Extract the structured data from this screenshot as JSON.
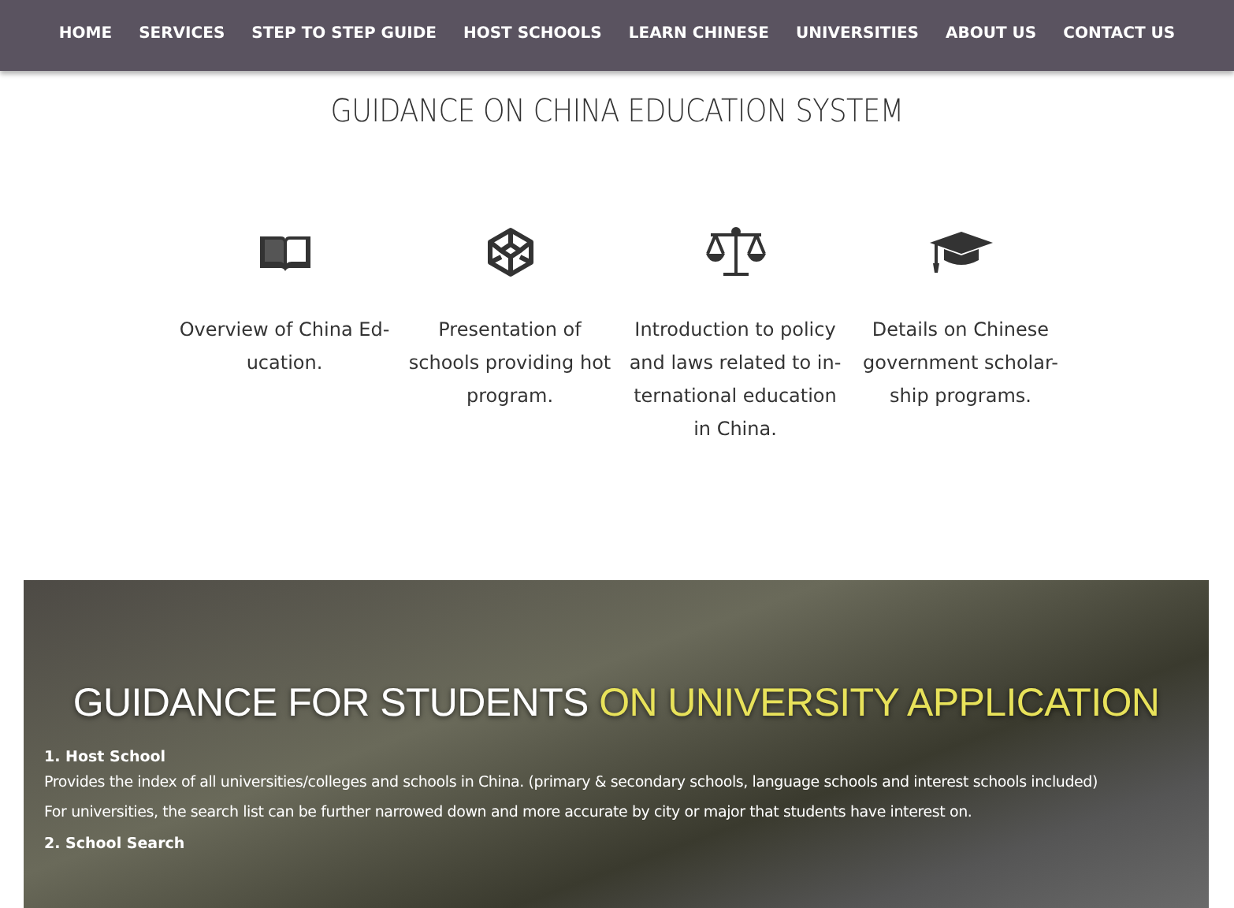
{
  "nav": {
    "items": [
      {
        "label": "HOME"
      },
      {
        "label": "SERVICES"
      },
      {
        "label": "STEP TO STEP GUIDE"
      },
      {
        "label": "HOST SCHOOLS"
      },
      {
        "label": "LEARN CHINESE"
      },
      {
        "label": "UNIVERSITIES"
      },
      {
        "label": "ABOUT US"
      },
      {
        "label": "CONTACT US"
      }
    ]
  },
  "section_title": "GUIDANCE ON CHINA EDUCATION SYSTEM",
  "features": [
    {
      "kind": "book",
      "lines": [
        "Overview of China Ed-",
        "ucation."
      ]
    },
    {
      "kind": "cube",
      "lines": [
        "Presentation of",
        "schools providing hot",
        "program."
      ]
    },
    {
      "kind": "scale",
      "lines": [
        "Introduction to policy",
        "and laws related to in-",
        "ternational education",
        "in China."
      ]
    },
    {
      "kind": "cap",
      "lines": [
        "Details on Chinese",
        "government scholar-",
        "ship programs."
      ]
    }
  ],
  "banner": {
    "title": "GUIDANCE FOR STUDENTS",
    "title_highlight": "ON UNIVERSITY APPLICATION",
    "sections": [
      {
        "heading": "1. Host School",
        "paragraphs": [
          "Provides the index of all universities/colleges and schools in China. (primary & secondary schools, language schools and interest schools included)",
          "For universities, the search list can be further narrowed down and more accurate by city or major that students have interest on."
        ]
      },
      {
        "heading": "2. School Search"
      }
    ]
  }
}
